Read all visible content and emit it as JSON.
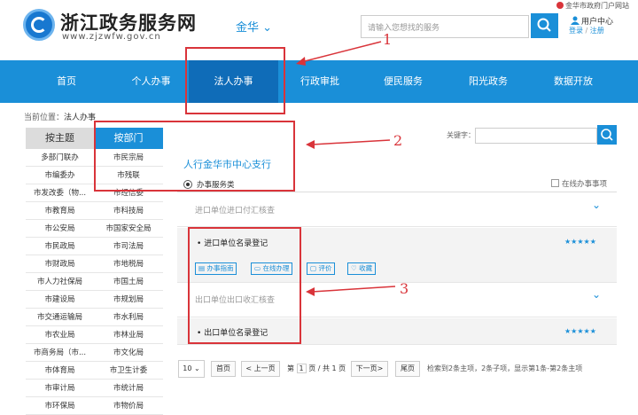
{
  "header": {
    "site_title": "浙江政务服务网",
    "site_url": "www.zjzwfw.gov.cn",
    "city": "金华",
    "city_chevron": "⌄",
    "portal_link": "金华市政府门户网站",
    "search_placeholder": "请输入您想找的服务",
    "user_center": "用户中心",
    "login": "登录",
    "separator": "/",
    "register": "注册"
  },
  "nav": {
    "items": [
      "首页",
      "个人办事",
      "法人办事",
      "行政审批",
      "便民服务",
      "阳光政务",
      "数据开放"
    ],
    "active": "法人办事"
  },
  "breadcrumb": {
    "label": "当前位置：",
    "current": "法人办事"
  },
  "sidebar": {
    "tabs": [
      "按主题",
      "按部门"
    ],
    "active_tab": "按部门",
    "departments": [
      [
        "多部门联办",
        "市民宗局"
      ],
      [
        "市编委办",
        "市残联"
      ],
      [
        "市发改委（物...",
        "市经信委"
      ],
      [
        "市教育局",
        "市科技局"
      ],
      [
        "市公安局",
        "市国家安全局"
      ],
      [
        "市民政局",
        "市司法局"
      ],
      [
        "市财政局",
        "市地税局"
      ],
      [
        "市人力社保局",
        "市国土局"
      ],
      [
        "市建设局",
        "市规划局"
      ],
      [
        "市交通运输局",
        "市水利局"
      ],
      [
        "市农业局",
        "市林业局"
      ],
      [
        "市商务局（市...",
        "市文化局"
      ],
      [
        "市体育局",
        "市卫生计委"
      ],
      [
        "市审计局",
        "市统计局"
      ],
      [
        "市环保局",
        "市物价局"
      ]
    ]
  },
  "main": {
    "keyword_label": "关键字：",
    "org_title": "人行金华市中心支行",
    "category": "办事服务类",
    "online_checkbox_label": "在线办事事项",
    "items": [
      {
        "title": "进口单位进口付汇核查",
        "expanded": false
      },
      {
        "title": "进口单位名录登记",
        "expanded": true,
        "rating": 5
      },
      {
        "title": "出口单位出口收汇核查",
        "expanded": false
      },
      {
        "title": "出口单位名录登记",
        "expanded": true,
        "rating": 5
      }
    ],
    "actions": [
      "办事指南",
      "在线办理",
      "评价",
      "收藏"
    ],
    "star_glyphs": "★★★★★",
    "bullet": "•",
    "chevron": "⌄"
  },
  "pagination": {
    "page_size": "10",
    "size_chevron": "⌄",
    "first": "首页",
    "prev": "< 上一页",
    "page_prefix": "第",
    "current_page": "1",
    "page_suffix": "页 / 共 1 页",
    "next": "下一页>",
    "last": "尾页",
    "summary": "检索到2条主项，2条子项，显示第1条-第2条主项"
  },
  "annotations": {
    "labels": [
      "1",
      "2",
      "3"
    ],
    "color": "#d9343a"
  },
  "colors": {
    "accent": "#1a8fd8",
    "nav_active": "#0f6cb8",
    "annotation": "#d9343a"
  }
}
